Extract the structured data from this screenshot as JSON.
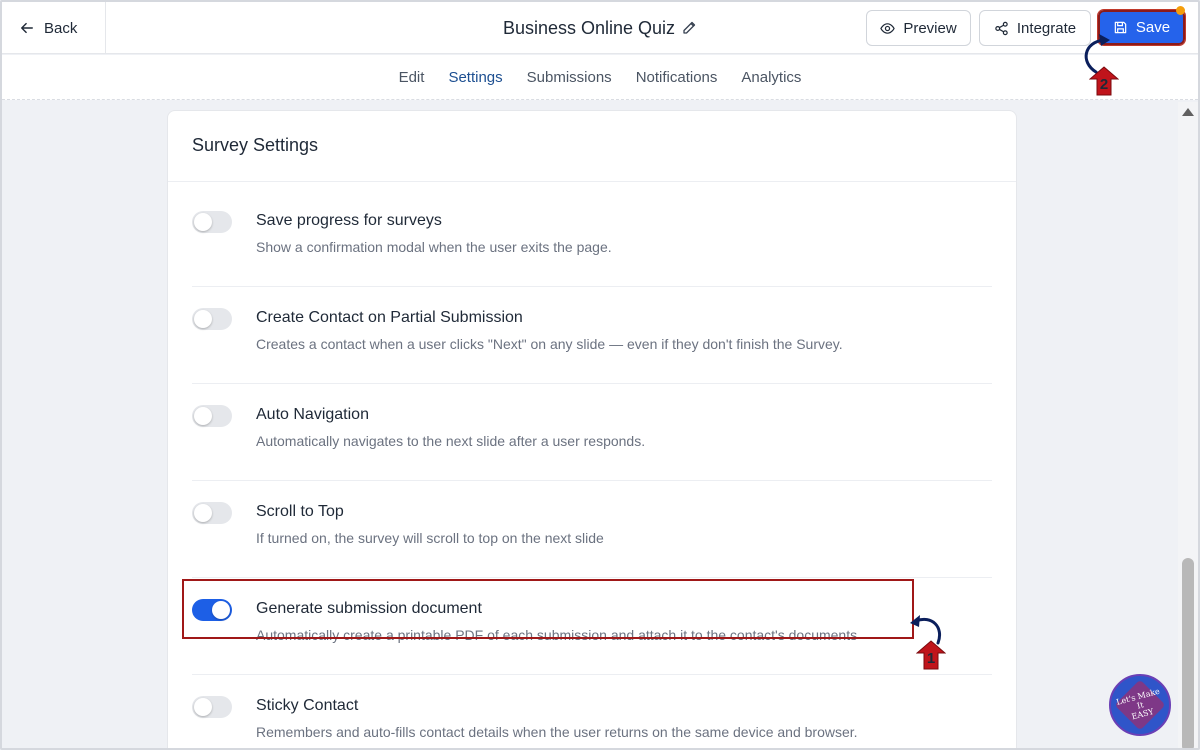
{
  "topbar": {
    "back_label": "Back",
    "title": "Business Online Quiz",
    "preview_label": "Preview",
    "integrate_label": "Integrate",
    "save_label": "Save"
  },
  "tabs": [
    {
      "label": "Edit",
      "active": false
    },
    {
      "label": "Settings",
      "active": true
    },
    {
      "label": "Submissions",
      "active": false
    },
    {
      "label": "Notifications",
      "active": false
    },
    {
      "label": "Analytics",
      "active": false
    }
  ],
  "card": {
    "title": "Survey Settings",
    "settings": [
      {
        "label": "Save progress for surveys",
        "description": "Show a confirmation modal when the user exits the page.",
        "enabled": false
      },
      {
        "label": "Create Contact on Partial Submission",
        "description": "Creates a contact when a user clicks \"Next\" on any slide — even if they don't finish the Survey.",
        "enabled": false
      },
      {
        "label": "Auto Navigation",
        "description": "Automatically navigates to the next slide after a user responds.",
        "enabled": false
      },
      {
        "label": "Scroll to Top",
        "description": "If turned on, the survey will scroll to top on the next slide",
        "enabled": false
      },
      {
        "label": "Generate submission document",
        "description": "Automatically create a printable PDF of each submission and attach it to the contact's documents",
        "enabled": true
      },
      {
        "label": "Sticky Contact",
        "description": "Remembers and auto-fills contact details when the user returns on the same device and browser.",
        "enabled": false
      }
    ]
  },
  "annotations": {
    "step1": "1",
    "step2": "2"
  },
  "logo": {
    "text_line1": "Let's Make",
    "text_line2": "It",
    "text_line3": "EASY"
  },
  "colors": {
    "accent": "#2563eb",
    "toggle_on": "#1d5fe6",
    "highlight_border": "#a01818",
    "marker_red": "#c0141b"
  }
}
